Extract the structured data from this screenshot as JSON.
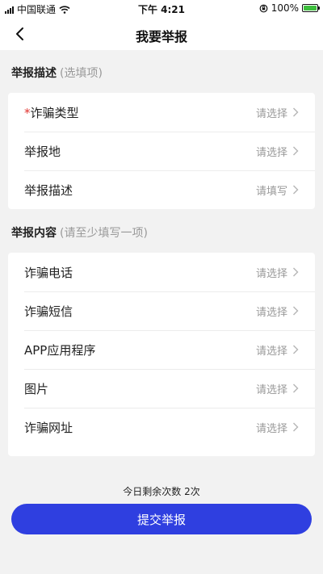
{
  "status_bar": {
    "carrier": "中国联通",
    "time": "下午 4:21",
    "battery": "100%",
    "battery_level": 1.0
  },
  "nav": {
    "title": "我要举报",
    "back_icon": "chevron-left-icon"
  },
  "section_desc": {
    "title": "举报描述",
    "hint": "(选填项)",
    "rows": [
      {
        "required_mark": "*",
        "label": "诈骗类型",
        "value": "请选择"
      },
      {
        "label": "举报地",
        "value": "请选择"
      },
      {
        "label": "举报描述",
        "value": "请填写"
      }
    ]
  },
  "section_content": {
    "title": "举报内容",
    "hint": "(请至少填写一项)",
    "rows": [
      {
        "label": "诈骗电话",
        "value": "请选择"
      },
      {
        "label": "诈骗短信",
        "value": "请选择"
      },
      {
        "label": "APP应用程序",
        "value": "请选择"
      },
      {
        "label": "图片",
        "value": "请选择"
      },
      {
        "label": "诈骗网址",
        "value": "请选择"
      }
    ]
  },
  "footer": {
    "remaining": "今日剩余次数 2次",
    "submit_label": "提交举报"
  },
  "colors": {
    "accent": "#2f3fe0",
    "required": "#e0322e",
    "background": "#f2f2f2",
    "placeholder": "#9a9a9a"
  }
}
